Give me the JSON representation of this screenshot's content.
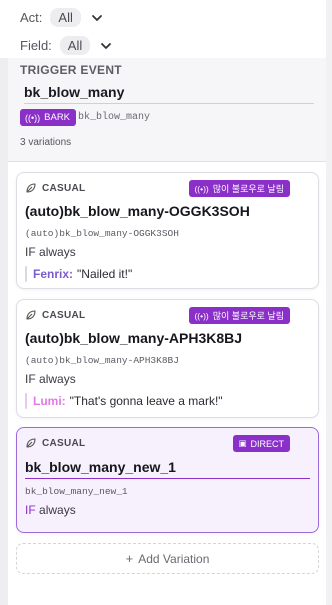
{
  "filters": {
    "act": {
      "label": "Act:",
      "value": "All"
    },
    "field": {
      "label": "Field:",
      "value": "All"
    }
  },
  "trigger": {
    "heading": "TRIGGER EVENT",
    "value": "bk_blow_many",
    "badge_label": "BARK",
    "bark_id": "bk_blow_many",
    "variations_count": "3 variations"
  },
  "cards": [
    {
      "type_label": "CASUAL",
      "tag_label": "많이 불로우로 날림",
      "title": "(auto)bk_blow_many-OGGK3SOH",
      "id": "(auto)bk_blow_many-OGGK3SOH",
      "cond_keyword": "IF",
      "cond_value": "always",
      "speaker": "Fenrix:",
      "line": "\"Nailed it!\"",
      "speaker_color": "#7a5ccf"
    },
    {
      "type_label": "CASUAL",
      "tag_label": "많이 불로우로 날림",
      "title": "(auto)bk_blow_many-APH3K8BJ",
      "id": "(auto)bk_blow_many-APH3K8BJ",
      "cond_keyword": "IF",
      "cond_value": "always",
      "speaker": "Lumi:",
      "line": "\"That's gonna leave a mark!\"",
      "speaker_color": "#e17ae6"
    },
    {
      "type_label": "CASUAL",
      "tag_label": "DIRECT",
      "title": "bk_blow_many_new_1",
      "id": "bk_blow_many_new_1",
      "cond_keyword": "IF",
      "cond_value": "always"
    }
  ],
  "add_variation_label": "Add Variation",
  "colors": {
    "accent": "#8b2fc9",
    "active_card_bg": "#f6f1fd"
  },
  "icons": {
    "filter_chevron": "chevron-down-icon",
    "card_type": "leaf-icon",
    "bark_tag": "broadcast-icon",
    "direct_tag": "direct-icon",
    "add": "plus-icon"
  }
}
